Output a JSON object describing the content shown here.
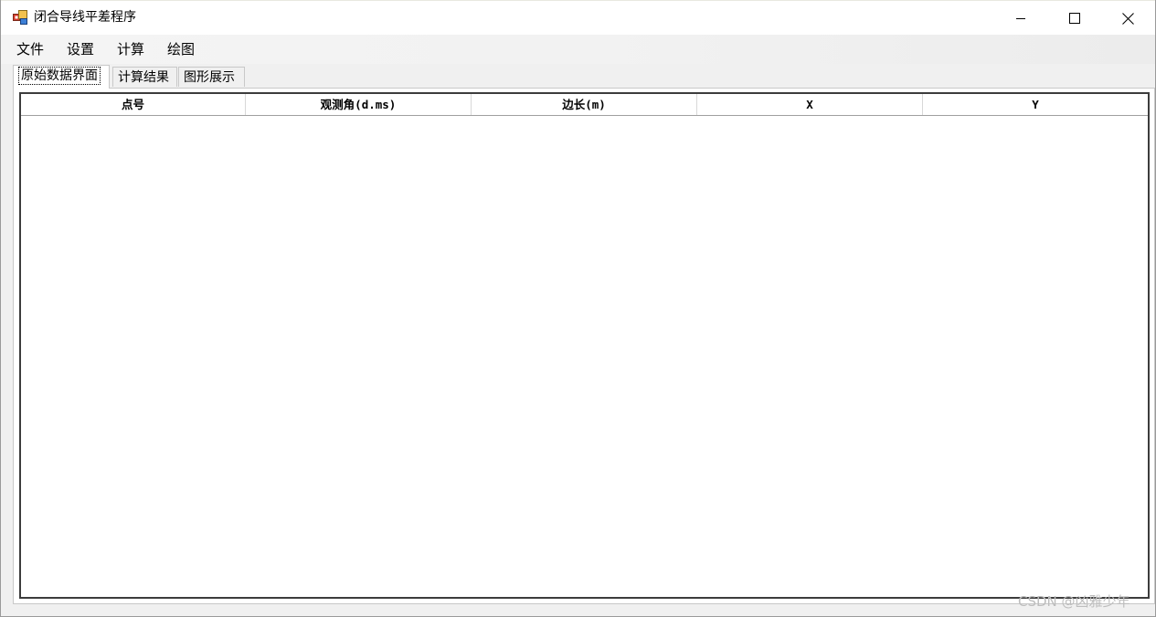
{
  "window": {
    "title": "闭合导线平差程序",
    "icon": "app-window-icon"
  },
  "menubar": {
    "items": [
      {
        "label": "文件"
      },
      {
        "label": "设置"
      },
      {
        "label": "计算"
      },
      {
        "label": "绘图"
      }
    ]
  },
  "tabs": [
    {
      "label": "原始数据界面",
      "active": true
    },
    {
      "label": "计算结果",
      "active": false
    },
    {
      "label": "图形展示",
      "active": false
    }
  ],
  "grid": {
    "columns": [
      "点号",
      "观测角(d.ms)",
      "边长(m)",
      "X",
      "Y"
    ],
    "rows": []
  },
  "watermark": "CSDN @凶雅少年",
  "colors": {
    "menubar_bg": "#f2f2f2",
    "window_bg": "#f0f0f0",
    "grid_border": "#3c3c3c"
  }
}
